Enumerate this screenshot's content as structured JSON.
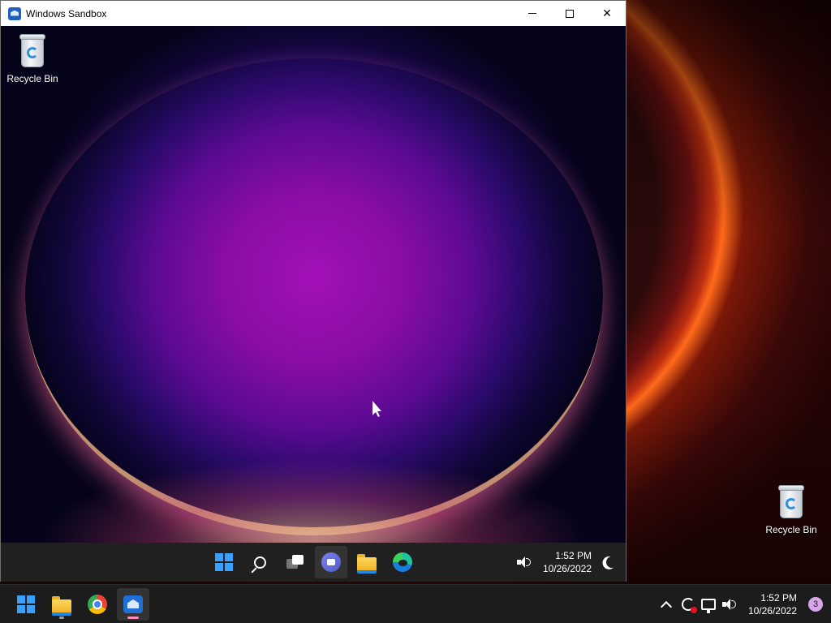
{
  "host": {
    "desktop_icons": [
      {
        "label": "Recycle Bin",
        "icon": "recycle-bin-icon"
      }
    ],
    "taskbar": {
      "apps": [
        {
          "name": "start",
          "icon": "windows-logo-icon"
        },
        {
          "name": "file-explorer",
          "icon": "folder-icon",
          "running": true
        },
        {
          "name": "chrome",
          "icon": "chrome-icon"
        },
        {
          "name": "windows-sandbox",
          "icon": "sandbox-icon",
          "active": true
        }
      ],
      "tray": {
        "time": "1:52 PM",
        "date": "10/26/2022",
        "notification_count": "3"
      }
    }
  },
  "sandbox_window": {
    "title": "Windows Sandbox",
    "controls": {
      "minimize": "minimize",
      "maximize": "maximize",
      "close": "close"
    },
    "desktop_icons": [
      {
        "label": "Recycle Bin",
        "icon": "recycle-bin-icon"
      }
    ],
    "taskbar": {
      "apps": [
        {
          "name": "start",
          "icon": "windows-logo-icon"
        },
        {
          "name": "search",
          "icon": "search-icon"
        },
        {
          "name": "task-view",
          "icon": "task-view-icon"
        },
        {
          "name": "chat",
          "icon": "chat-icon"
        },
        {
          "name": "file-explorer",
          "icon": "folder-icon"
        },
        {
          "name": "edge",
          "icon": "edge-icon"
        }
      ],
      "tray": {
        "time": "1:52 PM",
        "date": "10/26/2022"
      }
    }
  },
  "colors": {
    "accent": "#3aa0ff",
    "taskbar": "#202020",
    "titlebar": "#ffffff"
  }
}
